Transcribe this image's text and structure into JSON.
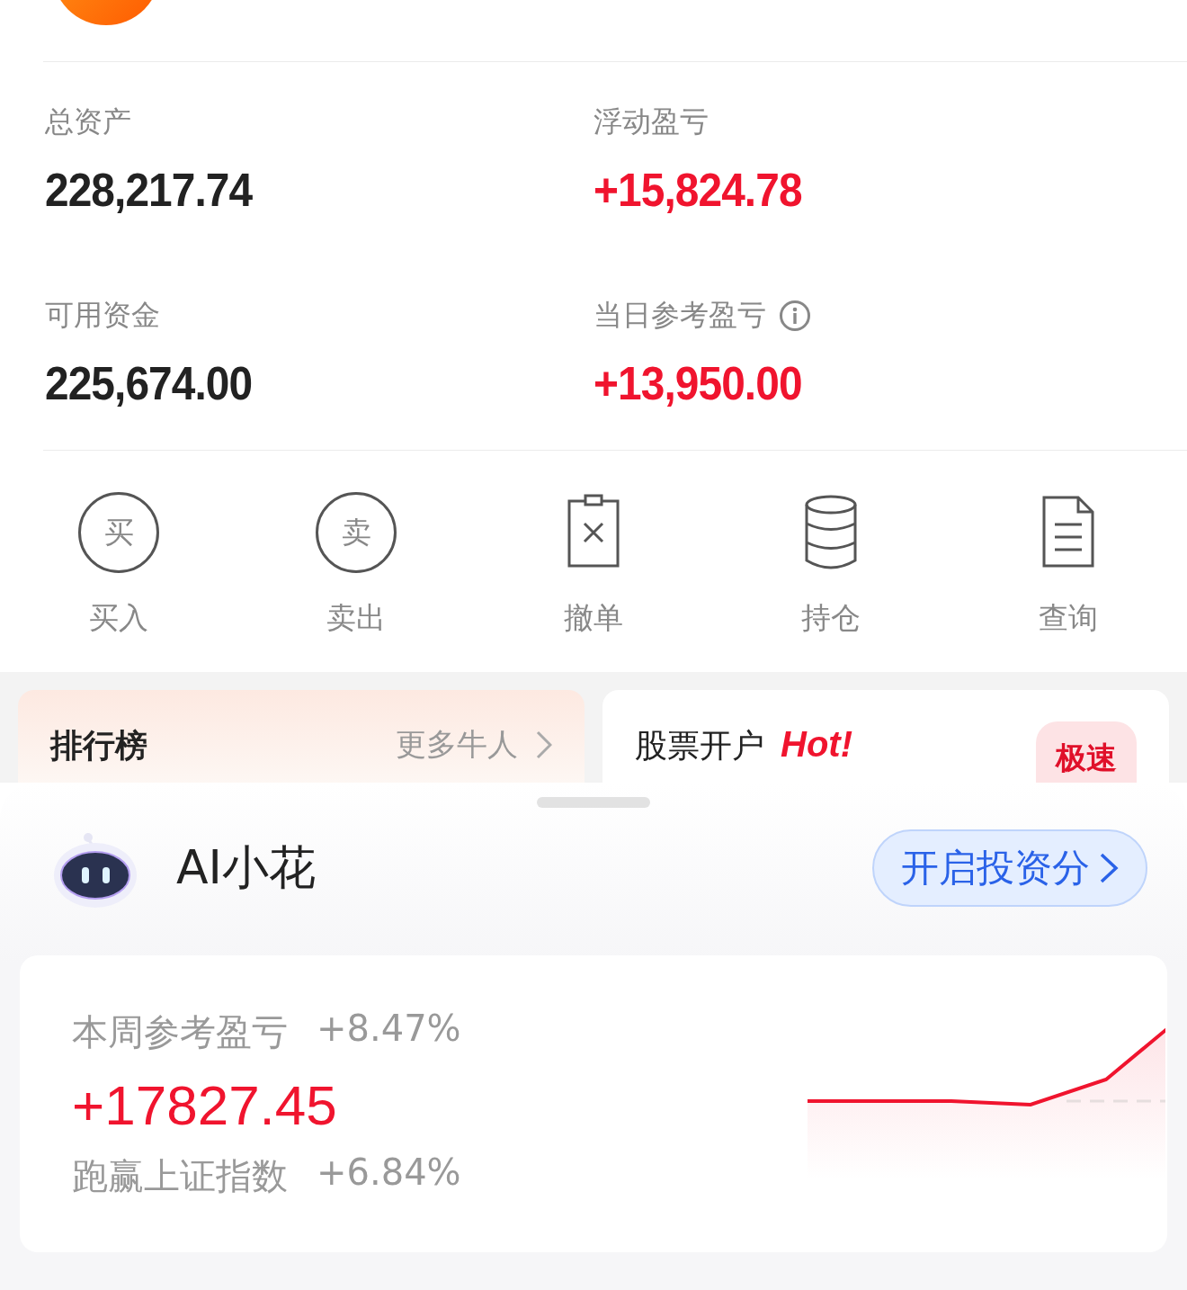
{
  "stats": [
    {
      "label": "总资产",
      "value": "228,217.74",
      "gain": false,
      "info": false
    },
    {
      "label": "浮动盈亏",
      "value": "+15,824.78",
      "gain": true,
      "info": false
    },
    {
      "label": "可用资金",
      "value": "225,674.00",
      "gain": false,
      "info": false
    },
    {
      "label": "当日参考盈亏",
      "value": "+13,950.00",
      "gain": true,
      "info": true
    }
  ],
  "actions": [
    {
      "label": "买入",
      "kind": "circle",
      "glyph": "买"
    },
    {
      "label": "卖出",
      "kind": "circle",
      "glyph": "卖"
    },
    {
      "label": "撤单",
      "kind": "cancel"
    },
    {
      "label": "持仓",
      "kind": "database"
    },
    {
      "label": "查询",
      "kind": "document"
    }
  ],
  "cards": [
    {
      "title": "排行榜",
      "link": "更多牛人",
      "kind": "ranking"
    },
    {
      "title": "股票开户",
      "tag": "Hot!",
      "badge": "极速",
      "kind": "account"
    }
  ],
  "assistant": {
    "name": "AI小花",
    "button": "开启投资分"
  },
  "weekly": {
    "label": "本周参考盈亏",
    "pct": "+8.47%",
    "amount": "+17827.45",
    "bench_label": "跑赢上证指数",
    "bench_pct": "+6.84%"
  }
}
